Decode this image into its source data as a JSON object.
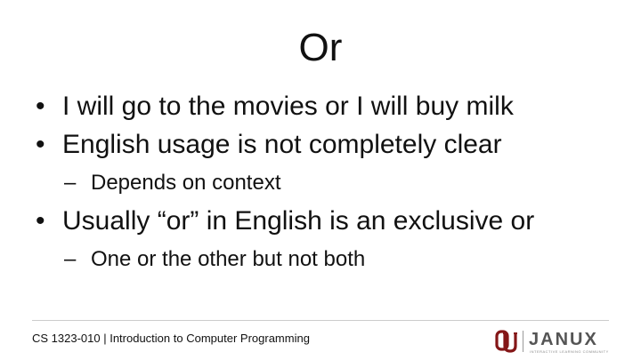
{
  "slide": {
    "title": "Or",
    "bullets": [
      {
        "text": "I will go to the movies or I will buy milk"
      },
      {
        "text": "English usage is not completely clear"
      },
      {
        "text": "Depends on context"
      },
      {
        "text": "Usually “or” in English is an exclusive or"
      },
      {
        "text": "One or the other but not both"
      }
    ],
    "bullet_symbol": "•",
    "sub_bullet_symbol": "–"
  },
  "footer": {
    "course": "CS 1323-010 | Introduction to Computer Programming",
    "logo_text": "JANUX",
    "logo_tagline": "INTERACTIVE LEARNING COMMUNITY",
    "colors": {
      "ou_crimson": "#841617",
      "janux_gray": "#555555"
    }
  }
}
